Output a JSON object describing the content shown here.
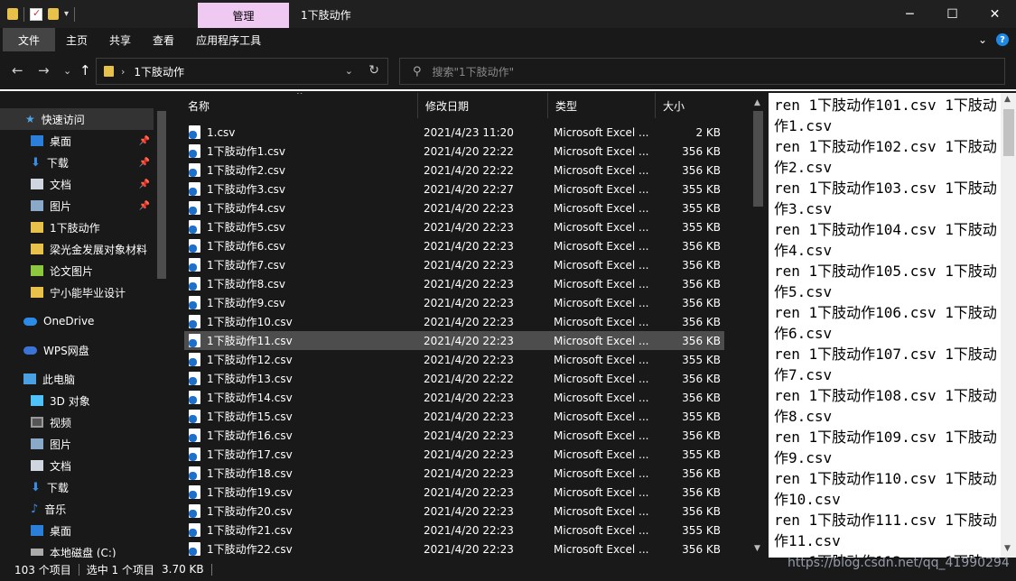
{
  "titlebar": {
    "context_tab": "管理",
    "title": "1下肢动作",
    "min": "─",
    "max": "☐",
    "close": "✕"
  },
  "ribbon": {
    "tabs": [
      "文件",
      "主页",
      "共享",
      "查看",
      "应用程序工具"
    ],
    "collapse": "⌄",
    "help": "?"
  },
  "nav": {
    "back": "←",
    "forward": "→",
    "recent": "⌄",
    "up": "↑",
    "address": "1下肢动作",
    "search_placeholder": "搜索\"1下肢动作\""
  },
  "sidebar": {
    "items": [
      {
        "label": "快速访问",
        "icon": "star-icon"
      },
      {
        "label": "桌面",
        "icon": "desktop-icon"
      },
      {
        "label": "下载",
        "icon": "download-icon"
      },
      {
        "label": "文档",
        "icon": "document-icon"
      },
      {
        "label": "图片",
        "icon": "picture-icon"
      },
      {
        "label": "1下肢动作",
        "icon": "folder-icon"
      },
      {
        "label": "梁光金发展对象材料",
        "icon": "folder-icon"
      },
      {
        "label": "论文图片",
        "icon": "folder-icon"
      },
      {
        "label": "宁小能毕业设计",
        "icon": "folder-icon"
      },
      {
        "label": "OneDrive",
        "icon": "cloud-icon"
      },
      {
        "label": "WPS网盘",
        "icon": "cloud-icon"
      },
      {
        "label": "此电脑",
        "icon": "computer-icon"
      },
      {
        "label": "3D 对象",
        "icon": "cube-icon"
      },
      {
        "label": "视频",
        "icon": "video-icon"
      },
      {
        "label": "图片",
        "icon": "picture-icon"
      },
      {
        "label": "文档",
        "icon": "document-icon"
      },
      {
        "label": "下载",
        "icon": "download-icon"
      },
      {
        "label": "音乐",
        "icon": "music-icon"
      },
      {
        "label": "桌面",
        "icon": "desktop-icon"
      },
      {
        "label": "本地磁盘 (C:)",
        "icon": "disk-icon"
      }
    ]
  },
  "columns": {
    "name": "名称",
    "date": "修改日期",
    "type": "类型",
    "size": "大小"
  },
  "files": [
    {
      "name": "1.csv",
      "date": "2021/4/23 11:20",
      "type": "Microsoft Excel ...",
      "size": "2 KB"
    },
    {
      "name": "1下肢动作1.csv",
      "date": "2021/4/20 22:22",
      "type": "Microsoft Excel ...",
      "size": "356 KB"
    },
    {
      "name": "1下肢动作2.csv",
      "date": "2021/4/20 22:22",
      "type": "Microsoft Excel ...",
      "size": "356 KB"
    },
    {
      "name": "1下肢动作3.csv",
      "date": "2021/4/20 22:27",
      "type": "Microsoft Excel ...",
      "size": "355 KB"
    },
    {
      "name": "1下肢动作4.csv",
      "date": "2021/4/20 22:23",
      "type": "Microsoft Excel ...",
      "size": "355 KB"
    },
    {
      "name": "1下肢动作5.csv",
      "date": "2021/4/20 22:23",
      "type": "Microsoft Excel ...",
      "size": "355 KB"
    },
    {
      "name": "1下肢动作6.csv",
      "date": "2021/4/20 22:23",
      "type": "Microsoft Excel ...",
      "size": "356 KB"
    },
    {
      "name": "1下肢动作7.csv",
      "date": "2021/4/20 22:23",
      "type": "Microsoft Excel ...",
      "size": "356 KB"
    },
    {
      "name": "1下肢动作8.csv",
      "date": "2021/4/20 22:23",
      "type": "Microsoft Excel ...",
      "size": "356 KB"
    },
    {
      "name": "1下肢动作9.csv",
      "date": "2021/4/20 22:23",
      "type": "Microsoft Excel ...",
      "size": "356 KB"
    },
    {
      "name": "1下肢动作10.csv",
      "date": "2021/4/20 22:23",
      "type": "Microsoft Excel ...",
      "size": "356 KB"
    },
    {
      "name": "1下肢动作11.csv",
      "date": "2021/4/20 22:23",
      "type": "Microsoft Excel ...",
      "size": "356 KB",
      "selected": true
    },
    {
      "name": "1下肢动作12.csv",
      "date": "2021/4/20 22:23",
      "type": "Microsoft Excel ...",
      "size": "355 KB"
    },
    {
      "name": "1下肢动作13.csv",
      "date": "2021/4/20 22:22",
      "type": "Microsoft Excel ...",
      "size": "356 KB"
    },
    {
      "name": "1下肢动作14.csv",
      "date": "2021/4/20 22:23",
      "type": "Microsoft Excel ...",
      "size": "356 KB"
    },
    {
      "name": "1下肢动作15.csv",
      "date": "2021/4/20 22:23",
      "type": "Microsoft Excel ...",
      "size": "355 KB"
    },
    {
      "name": "1下肢动作16.csv",
      "date": "2021/4/20 22:23",
      "type": "Microsoft Excel ...",
      "size": "356 KB"
    },
    {
      "name": "1下肢动作17.csv",
      "date": "2021/4/20 22:23",
      "type": "Microsoft Excel ...",
      "size": "355 KB"
    },
    {
      "name": "1下肢动作18.csv",
      "date": "2021/4/20 22:23",
      "type": "Microsoft Excel ...",
      "size": "356 KB"
    },
    {
      "name": "1下肢动作19.csv",
      "date": "2021/4/20 22:23",
      "type": "Microsoft Excel ...",
      "size": "356 KB"
    },
    {
      "name": "1下肢动作20.csv",
      "date": "2021/4/20 22:23",
      "type": "Microsoft Excel ...",
      "size": "356 KB"
    },
    {
      "name": "1下肢动作21.csv",
      "date": "2021/4/20 22:23",
      "type": "Microsoft Excel ...",
      "size": "355 KB"
    },
    {
      "name": "1下肢动作22.csv",
      "date": "2021/4/20 22:23",
      "type": "Microsoft Excel ...",
      "size": "356 KB"
    }
  ],
  "preview": {
    "text": "ren 1下肢动作101.csv 1下肢动作1.csv\nren 1下肢动作102.csv 1下肢动作2.csv\nren 1下肢动作103.csv 1下肢动作3.csv\nren 1下肢动作104.csv 1下肢动作4.csv\nren 1下肢动作105.csv 1下肢动作5.csv\nren 1下肢动作106.csv 1下肢动作6.csv\nren 1下肢动作107.csv 1下肢动作7.csv\nren 1下肢动作108.csv 1下肢动作8.csv\nren 1下肢动作109.csv 1下肢动作9.csv\nren 1下肢动作110.csv 1下肢动作10.csv\nren 1下肢动作111.csv 1下肢动作11.csv\nren 1下肢动作112.csv 1下肢"
  },
  "status": {
    "count": "103 个项目",
    "selection": "选中 1 个项目",
    "size": "3.70 KB",
    "watermark": "https://blog.csdn.net/qq_41990294"
  }
}
